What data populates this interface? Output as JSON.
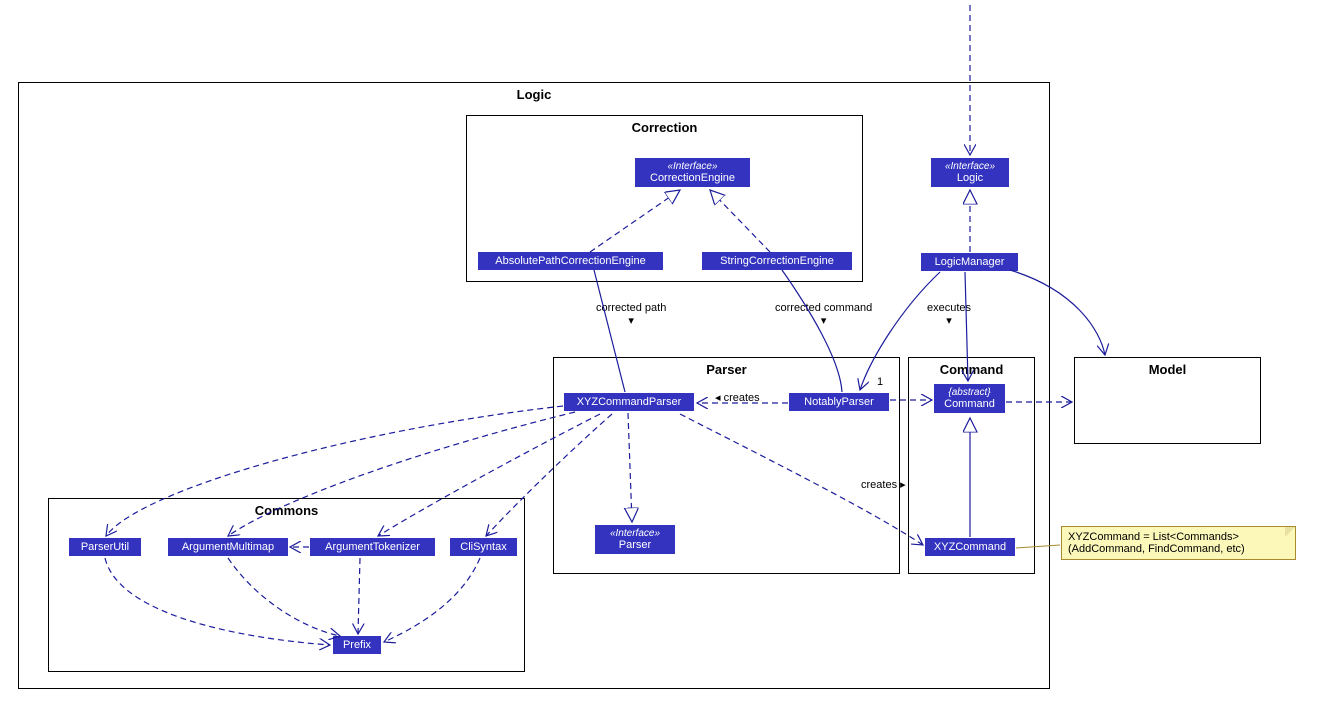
{
  "packages": {
    "logic": "Logic",
    "correction": "Correction",
    "parser": "Parser",
    "command": "Command",
    "commons": "Commons",
    "model": "Model"
  },
  "nodes": {
    "correctionEngine": {
      "stereo": "«Interface»",
      "name": "CorrectionEngine"
    },
    "absPathCorrection": {
      "name": "AbsolutePathCorrectionEngine"
    },
    "strCorrection": {
      "name": "StringCorrectionEngine"
    },
    "logicIface": {
      "stereo": "«Interface»",
      "name": "Logic"
    },
    "logicMgr": {
      "name": "LogicManager"
    },
    "xyzParser": {
      "name": "XYZCommandParser"
    },
    "notablyParser": {
      "name": "NotablyParser"
    },
    "parserIface": {
      "stereo": "«Interface»",
      "name": "Parser"
    },
    "absCommand": {
      "stereo": "{abstract}",
      "name": "Command"
    },
    "xyzCommand": {
      "name": "XYZCommand"
    },
    "parserUtil": {
      "name": "ParserUtil"
    },
    "argMulti": {
      "name": "ArgumentMultimap"
    },
    "argTok": {
      "name": "ArgumentTokenizer"
    },
    "cliSyntax": {
      "name": "CliSyntax"
    },
    "prefix": {
      "name": "Prefix"
    }
  },
  "labels": {
    "correctedPath": "corrected path",
    "correctedCmd": "corrected command",
    "executes": "executes",
    "creates": "creates",
    "creates2": "creates",
    "one": "1"
  },
  "note": {
    "line1": "XYZCommand = List<Commands>",
    "line2": "(AddCommand, FindCommand, etc)"
  }
}
